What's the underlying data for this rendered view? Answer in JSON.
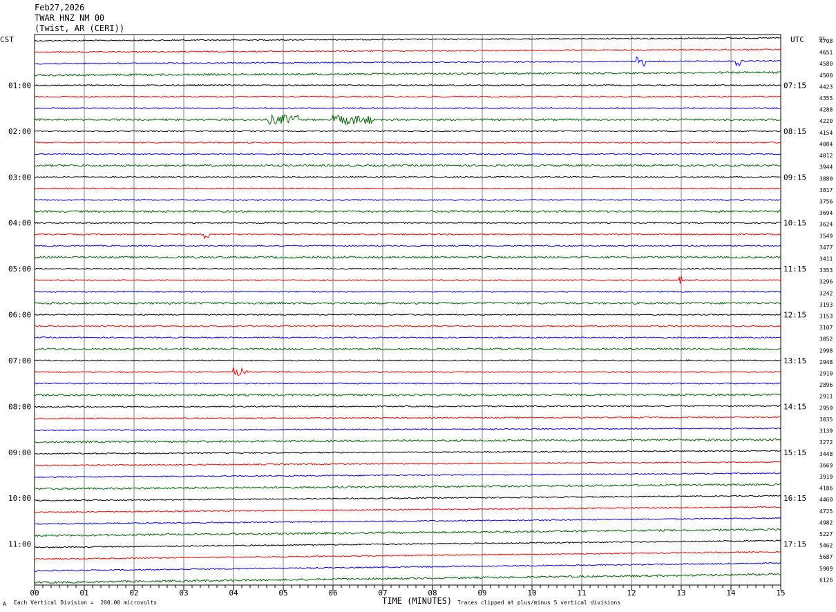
{
  "header": {
    "date": "Feb27,2026",
    "station": "TWAR HNZ NM 00",
    "location": "(Twist, AR (CERI))"
  },
  "axis_labels": {
    "left_tz": "CST",
    "right_tz": "UTC",
    "dc": "DC",
    "xlabel": "TIME (MINUTES)"
  },
  "footer": {
    "left": "Each Vertical Division =  200.00 microvolts",
    "right": "Traces clipped at plus/minus 5 vertical divisions",
    "mark": "A"
  },
  "colors": {
    "cycle": [
      "#000000",
      "#ff0000",
      "#0000ff",
      "#006600"
    ],
    "grid": "#808080"
  },
  "chart_data": {
    "type": "line",
    "title": "TWAR HNZ NM 00",
    "xlabel": "TIME (MINUTES)",
    "x_ticks": [
      "00",
      "01",
      "02",
      "03",
      "04",
      "05",
      "06",
      "07",
      "08",
      "09",
      "10",
      "11",
      "12",
      "13",
      "14",
      "15"
    ],
    "xlim": [
      0,
      15
    ],
    "line_count": 48,
    "minutes_per_line": 15,
    "left_hour_labels": [
      "01:00",
      "02:00",
      "03:00",
      "04:00",
      "05:00",
      "06:00",
      "07:00",
      "08:00",
      "09:00",
      "10:00",
      "11:00"
    ],
    "right_hour_labels": [
      "07:15",
      "08:15",
      "09:15",
      "10:15",
      "11:15",
      "12:15",
      "13:15",
      "14:15",
      "15:15",
      "16:15",
      "17:15"
    ],
    "dc_offsets": [
      4708,
      4651,
      4580,
      4500,
      4423,
      4355,
      4288,
      4220,
      4154,
      4084,
      4012,
      3944,
      3880,
      3817,
      3756,
      3694,
      3624,
      3549,
      3477,
      3411,
      3353,
      3296,
      3242,
      3193,
      3153,
      3107,
      3052,
      2998,
      2948,
      2910,
      2896,
      2911,
      2959,
      3035,
      3139,
      3272,
      3448,
      3669,
      3919,
      4186,
      4460,
      4725,
      4982,
      5227,
      5462,
      5687,
      5909,
      6126
    ],
    "events": [
      {
        "trace": 2,
        "minute_start": 12.1,
        "minute_end": 12.3
      },
      {
        "trace": 2,
        "minute_start": 14.1,
        "minute_end": 14.2
      },
      {
        "trace": 7,
        "minute_start": 4.7,
        "minute_end": 5.3
      },
      {
        "trace": 7,
        "minute_start": 6.0,
        "minute_end": 6.8
      },
      {
        "trace": 17,
        "minute_start": 3.4,
        "minute_end": 3.5
      },
      {
        "trace": 21,
        "minute_start": 12.95,
        "minute_end": 13.0
      },
      {
        "trace": 29,
        "minute_start": 4.0,
        "minute_end": 4.3
      }
    ]
  }
}
